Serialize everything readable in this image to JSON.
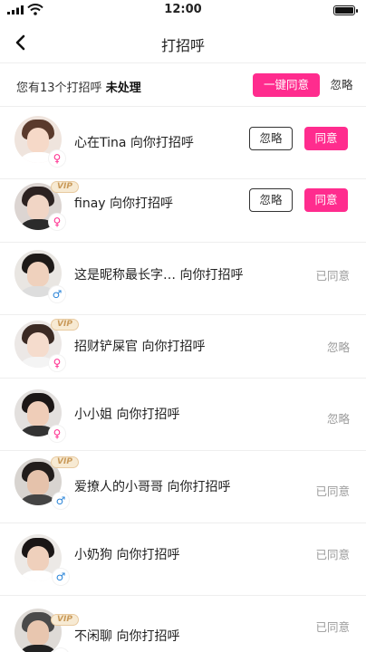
{
  "status_bar": {
    "time": "12:00"
  },
  "nav": {
    "title": "打招呼"
  },
  "summary": {
    "prefix": "您有13个打招呼",
    "pending": "未处理",
    "agree_all_label": "一键同意",
    "ignore_all_label": "忽略"
  },
  "colors": {
    "accent": "#ff2c8e",
    "female": "#ff2c8e",
    "male": "#2d86d8",
    "status_grey": "#9a9a9a"
  },
  "items": [
    {
      "name": "心在Tina",
      "suffix": " 向你打招呼",
      "gender": "♀",
      "vip": "",
      "ignore_label": "忽略",
      "agree_label": "同意",
      "status": ""
    },
    {
      "name": "finay",
      "suffix": " 向你打招呼",
      "gender": "♀",
      "vip": "VIP",
      "ignore_label": "忽略",
      "agree_label": "同意",
      "status": ""
    },
    {
      "name": "这是昵称最长字…",
      "suffix": " 向你打招呼",
      "gender": "♂",
      "vip": "",
      "status": "已同意"
    },
    {
      "name": "招财铲屎官",
      "suffix": " 向你打招呼",
      "gender": "♀",
      "vip": "VIP",
      "status": "忽略"
    },
    {
      "name": "小小姐",
      "suffix": " 向你打招呼",
      "gender": "♀",
      "vip": "",
      "status": "忽略"
    },
    {
      "name": "爱撩人的小哥哥",
      "suffix": " 向你打招呼",
      "gender": "♂",
      "vip": "VIP",
      "status": "已同意"
    },
    {
      "name": "小奶狗",
      "suffix": " 向你打招呼",
      "gender": "♂",
      "vip": "",
      "status": "已同意"
    },
    {
      "name": "不闲聊",
      "suffix": " 向你打招呼",
      "gender": "♂",
      "vip": "VIP",
      "status": "已同意"
    }
  ]
}
